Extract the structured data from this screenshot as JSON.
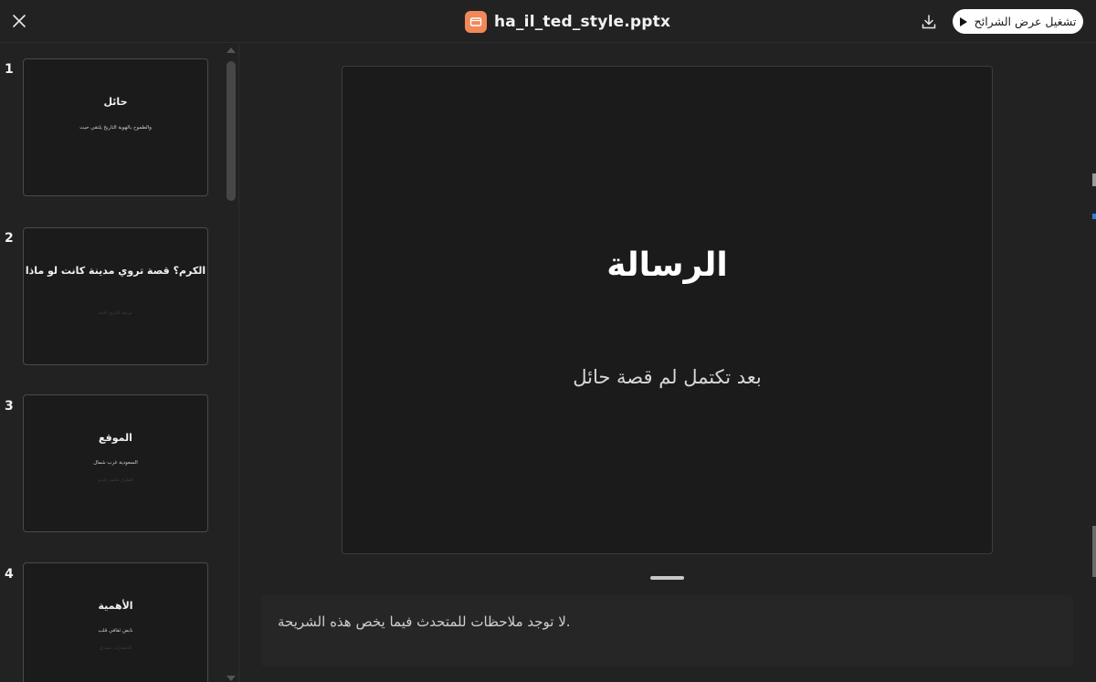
{
  "header": {
    "file_name": "ha_il_ted_style.pptx",
    "play_label": "تشغيل عرض الشرائح",
    "icons": {
      "close": "close-icon",
      "file": "presentation-file-icon",
      "download": "download-icon",
      "play": "play-icon"
    },
    "file_icon_color": "#f0885a"
  },
  "thumbnails": [
    {
      "number": "1",
      "title": "حائل",
      "subtitle": "والطموح بالهوية التاريخ يلتقي حيث",
      "faint": ""
    },
    {
      "number": "2",
      "title": "الكرم؟ قصة تروي مدينة كانت لو ماذا",
      "subtitle": "",
      "faint": "عريقة لتاريخ نافذة"
    },
    {
      "number": "3",
      "title": "الموقع",
      "subtitle": "السعودية غرب شمال",
      "faint": "الطرق ملتقى قديم"
    },
    {
      "number": "4",
      "title": "الأهمية",
      "subtitle": "نابض ثقافي قلب",
      "faint": "الحضارات مفترق"
    }
  ],
  "slide": {
    "title": "الرسالة",
    "subtitle": "بعد تكتمل لم قصة حائل"
  },
  "notes": {
    "text": ".لا توجد ملاحظات للمتحدث فيما يخص هذه الشريحة"
  }
}
